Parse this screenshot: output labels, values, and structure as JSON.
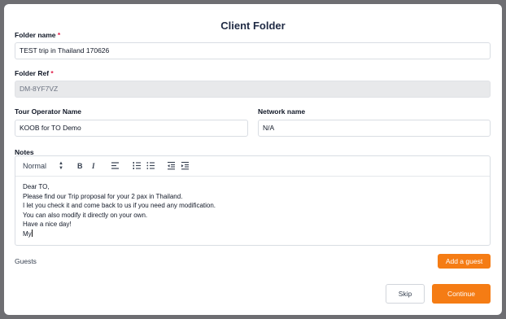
{
  "modal": {
    "title": "Client Folder"
  },
  "fields": {
    "folder_name": {
      "label": "Folder name",
      "required_mark": "*",
      "value": "TEST trip in Thailand 170626"
    },
    "folder_ref": {
      "label": "Folder Ref",
      "required_mark": "*",
      "value": "DM-8YF7VZ"
    },
    "tour_operator": {
      "label": "Tour Operator Name",
      "value": "KOOB for TO Demo"
    },
    "network": {
      "label": "Network name",
      "value": "N/A"
    }
  },
  "notes": {
    "label": "Notes",
    "toolbar": {
      "format_select": "Normal",
      "bold": "B",
      "italic": "I",
      "icons": [
        "align-left-icon",
        "ordered-list-icon",
        "bullet-list-icon",
        "outdent-icon",
        "indent-icon"
      ]
    },
    "lines": [
      "Dear TO,",
      "Please find our Trip proposal for your 2 pax in Thailand.",
      "I let you check it and come back to us if you need any modification.",
      "You can also modify it directly on your own.",
      "Have a nice day!",
      "My"
    ]
  },
  "guests": {
    "label": "Guests",
    "add_button": "Add a guest"
  },
  "footer": {
    "skip": "Skip",
    "continue": "Continue"
  },
  "colors": {
    "accent": "#f57c14",
    "required": "#e11d48",
    "disabled_bg": "#e8e9eb"
  }
}
